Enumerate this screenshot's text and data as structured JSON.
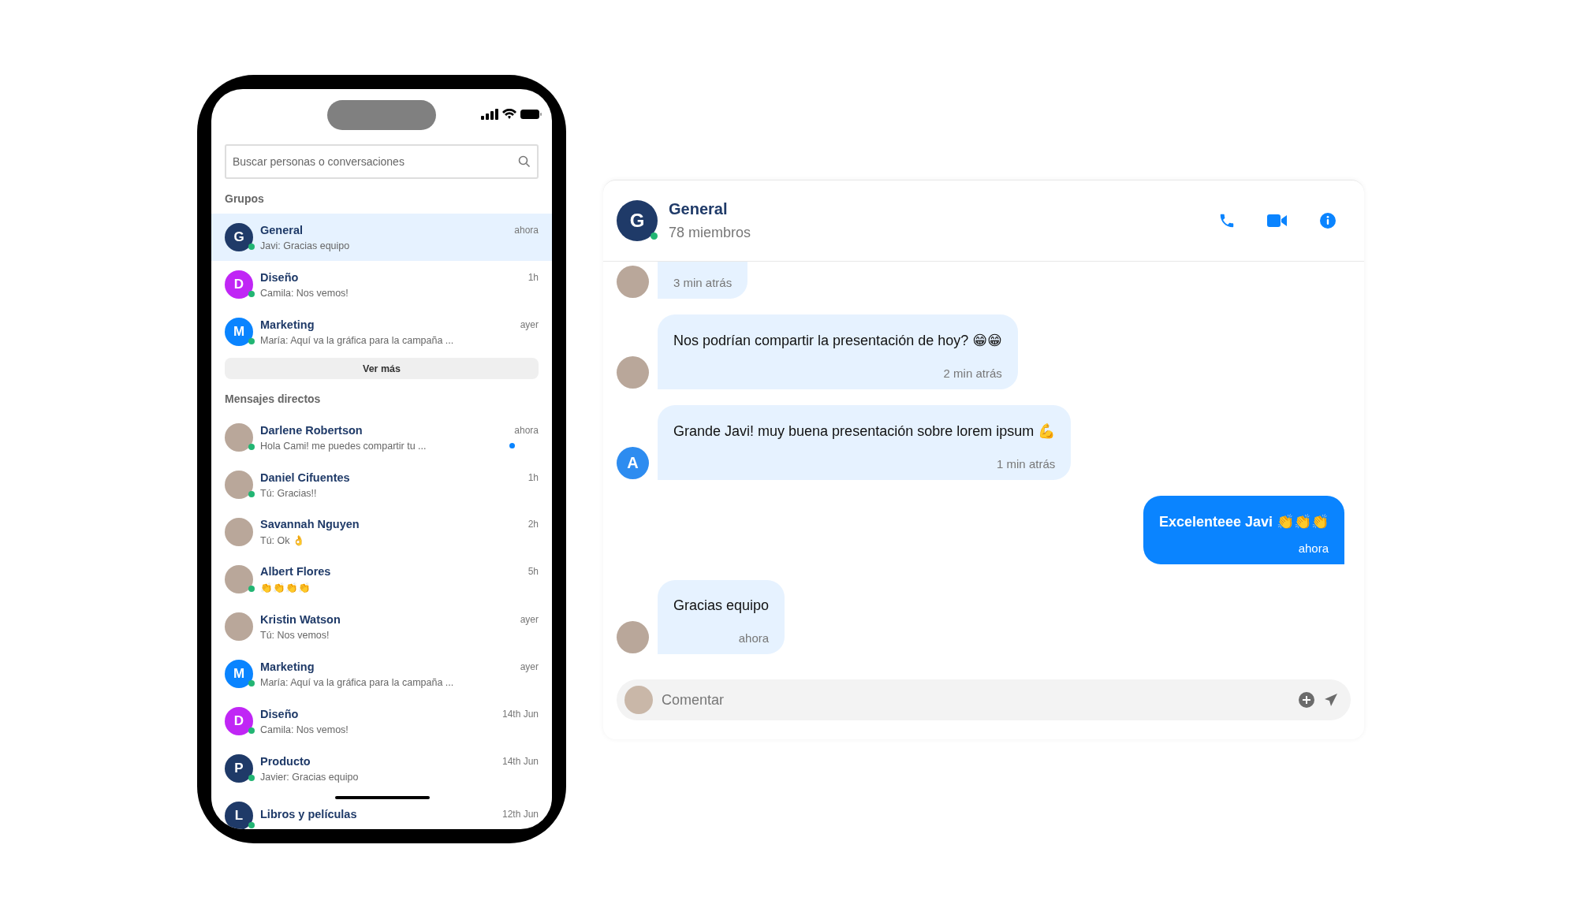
{
  "phone": {
    "search": {
      "placeholder": "Buscar personas o conversaciones"
    },
    "sections": [
      {
        "title": "Grupos",
        "more_button": "Ver más",
        "chats": [
          {
            "name": "General",
            "preview": "Javi: Gracias equipo",
            "time": "ahora",
            "avatar": {
              "kind": "letter",
              "letter": "G",
              "color": "#1f3a68"
            },
            "online": true,
            "unread": false,
            "selected": true
          },
          {
            "name": "Diseño",
            "preview": "Camila: Nos vemos!",
            "time": "1h",
            "avatar": {
              "kind": "letter",
              "letter": "D",
              "color": "#c026f5"
            },
            "online": true,
            "unread": false,
            "selected": false
          },
          {
            "name": "Marketing",
            "preview": "María: Aquí va la gráfica para la campaña ...",
            "time": "ayer",
            "avatar": {
              "kind": "letter",
              "letter": "M",
              "color": "#0a84ff"
            },
            "online": true,
            "unread": false,
            "selected": false
          }
        ]
      },
      {
        "title": "Mensajes directos",
        "chats": [
          {
            "name": "Darlene Robertson",
            "preview": "Hola Cami! me puedes compartir tu ...",
            "time": "ahora",
            "avatar": {
              "kind": "photo"
            },
            "online": true,
            "unread": true,
            "selected": false
          },
          {
            "name": "Daniel Cifuentes",
            "preview": "Tú: Gracias!!",
            "time": "1h",
            "avatar": {
              "kind": "photo"
            },
            "online": true,
            "unread": false,
            "selected": false
          },
          {
            "name": "Savannah Nguyen",
            "preview": "Tú: Ok 👌",
            "time": "2h",
            "avatar": {
              "kind": "photo"
            },
            "online": false,
            "unread": false,
            "selected": false
          },
          {
            "name": "Albert Flores",
            "preview": "👏👏👏👏",
            "time": "5h",
            "avatar": {
              "kind": "photo"
            },
            "online": true,
            "unread": false,
            "selected": false
          },
          {
            "name": "Kristin Watson",
            "preview": "Tú: Nos vemos!",
            "time": "ayer",
            "avatar": {
              "kind": "photo"
            },
            "online": false,
            "unread": false,
            "selected": false
          },
          {
            "name": "Marketing",
            "preview": "María: Aquí va la gráfica para la campaña ...",
            "time": "ayer",
            "avatar": {
              "kind": "letter",
              "letter": "M",
              "color": "#0a84ff"
            },
            "online": true,
            "unread": false,
            "selected": false
          },
          {
            "name": "Diseño",
            "preview": "Camila: Nos vemos!",
            "time": "14th Jun",
            "avatar": {
              "kind": "letter",
              "letter": "D",
              "color": "#c026f5"
            },
            "online": true,
            "unread": false,
            "selected": false
          },
          {
            "name": "Producto",
            "preview": "Javier: Gracias equipo",
            "time": "14th Jun",
            "avatar": {
              "kind": "letter",
              "letter": "P",
              "color": "#1f3a68"
            },
            "online": true,
            "unread": false,
            "selected": false
          },
          {
            "name": "Libros y películas",
            "time": "12th Jun",
            "avatar": {
              "kind": "letter",
              "letter": "L",
              "color": "#1f3a68"
            },
            "online": true,
            "unread": false,
            "selected": false
          }
        ]
      }
    ]
  },
  "chat": {
    "header": {
      "avatar_letter": "G",
      "title": "General",
      "subtitle": "78 miembros",
      "online": true
    },
    "messages": [
      {
        "kind": "received",
        "avatar": {
          "kind": "photo"
        },
        "time": "3 min atrás"
      },
      {
        "kind": "received",
        "avatar": {
          "kind": "photo"
        },
        "text": "Nos podrían compartir la presentación de hoy? 😁😁",
        "time": "2 min atrás"
      },
      {
        "kind": "received",
        "avatar": {
          "kind": "letter",
          "letter": "A",
          "color": "#2d8cf0"
        },
        "text": "Grande Javi! muy buena presentación sobre lorem ipsum 💪",
        "time": "1 min atrás"
      },
      {
        "kind": "sent",
        "text": "Excelenteee Javi 👏👏👏",
        "time": "ahora"
      },
      {
        "kind": "received",
        "avatar": {
          "kind": "photo"
        },
        "text": "Gracias equipo",
        "time": "ahora"
      }
    ],
    "composer": {
      "placeholder": "Comentar"
    }
  }
}
